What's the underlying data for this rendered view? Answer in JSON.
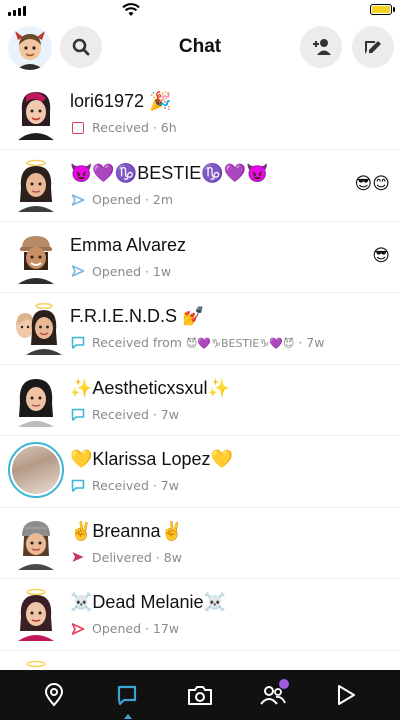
{
  "status_bar": {
    "signal_icon": "cellular-signal-icon",
    "wifi_icon": "wifi-icon",
    "battery_icon": "battery-icon"
  },
  "header": {
    "title": "Chat",
    "search_icon": "search-icon",
    "add_friend_icon": "add-friend-icon",
    "new_chat_icon": "new-chat-icon"
  },
  "chats": [
    {
      "name": "lori61972 🎉",
      "status_icon": "received-snap-square-icon",
      "status": "Received · 6h",
      "right": ""
    },
    {
      "name": "😈💜♑BESTIE♑💜😈",
      "status_icon": "opened-arrow-icon",
      "status": "Opened · 2m",
      "right": "😎😊"
    },
    {
      "name": "Emma Alvarez",
      "status_icon": "opened-arrow-icon",
      "status": "Opened · 1w",
      "right": "😎"
    },
    {
      "name": "F.R.I.E.N.D.S 💅",
      "status_icon": "received-chat-icon",
      "status_prefix": "Received from ",
      "status_from": "😈💜♑BESTIE♑💜😈",
      "status_suffix": " · 7w",
      "right": ""
    },
    {
      "name": "✨Aestheticxsxul✨",
      "status_icon": "received-chat-icon",
      "status": "Received · 7w",
      "right": ""
    },
    {
      "name": "💛Klarissa Lopez💛",
      "status_icon": "received-chat-icon",
      "status": "Received · 7w",
      "right": ""
    },
    {
      "name": "✌️Breanna✌️",
      "status_icon": "delivered-arrow-icon",
      "status": "Delivered · 8w",
      "right": ""
    },
    {
      "name": "☠️Dead Melanie☠️",
      "status_icon": "opened-arrow-icon",
      "status": "Opened · 17w",
      "right": ""
    }
  ],
  "colors": {
    "received_snap": "#e0405a",
    "opened": "#7ab6e0",
    "received_chat": "#3ab6d6",
    "delivered": "#c23a5f",
    "story_ring": "#3ab6d6",
    "nav_bg": "#111111",
    "nav_active": "#3aa4d6",
    "notification_dot": "#a05ae0"
  },
  "bottom_nav": {
    "items": [
      "map-pin-icon",
      "chat-icon",
      "camera-icon",
      "friends-icon",
      "play-icon"
    ],
    "active": "chat-icon"
  }
}
